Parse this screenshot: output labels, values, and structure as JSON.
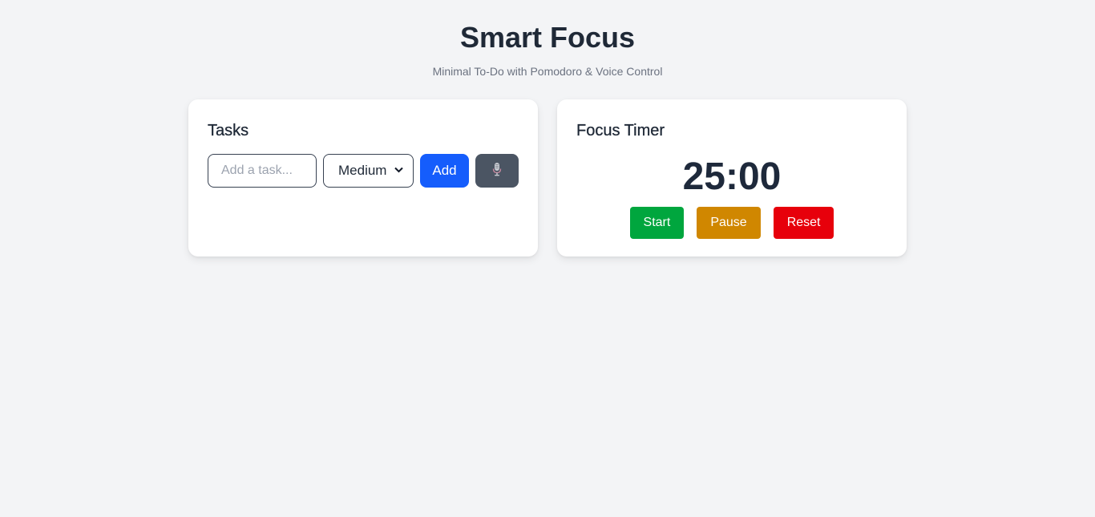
{
  "header": {
    "title": "Smart Focus",
    "subtitle": "Minimal To-Do with Pomodoro & Voice Control"
  },
  "tasks": {
    "title": "Tasks",
    "input_placeholder": "Add a task...",
    "input_value": "",
    "priority_selected": "Medium",
    "add_label": "Add",
    "mic_icon": "microphone-icon"
  },
  "timer": {
    "title": "Focus Timer",
    "display": "25:00",
    "start_label": "Start",
    "pause_label": "Pause",
    "reset_label": "Reset"
  },
  "colors": {
    "background": "#f3f4f6",
    "add_button": "#155dfc",
    "mic_button": "#4b5563",
    "start_button": "#00a63e",
    "pause_button": "#d08700",
    "reset_button": "#e7000b"
  }
}
